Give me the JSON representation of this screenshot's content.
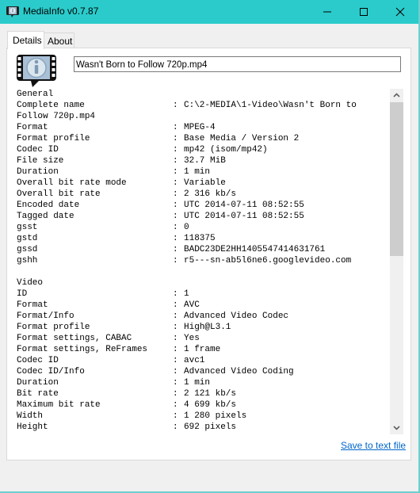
{
  "window": {
    "title": "MediaInfo v0.7.87",
    "minimize_icon": "minimize-icon",
    "maximize_icon": "maximize-icon",
    "close_icon": "close-icon",
    "titlebar_color": "#2bcbcb"
  },
  "tabs": [
    {
      "label": "Details",
      "active": true
    },
    {
      "label": "About",
      "active": false
    }
  ],
  "file": {
    "name": "Wasn't Born to Follow 720p.mp4",
    "logo_icon": "mediainfo-logo-icon"
  },
  "info": {
    "general_header": "General",
    "general": [
      {
        "key": "Complete name",
        "value": "C:\\2-MEDIA\\1-Video\\Wasn't Born to"
      },
      {
        "key": "Follow 720p.mp4",
        "value": ""
      },
      {
        "key": "Format",
        "value": "MPEG-4"
      },
      {
        "key": "Format profile",
        "value": "Base Media / Version 2"
      },
      {
        "key": "Codec ID",
        "value": "mp42 (isom/mp42)"
      },
      {
        "key": "File size",
        "value": "32.7 MiB"
      },
      {
        "key": "Duration",
        "value": "1 min"
      },
      {
        "key": "Overall bit rate mode",
        "value": "Variable"
      },
      {
        "key": "Overall bit rate",
        "value": "2 316 kb/s"
      },
      {
        "key": "Encoded date",
        "value": "UTC 2014-07-11 08:52:55"
      },
      {
        "key": "Tagged date",
        "value": "UTC 2014-07-11 08:52:55"
      },
      {
        "key": "gsst",
        "value": "0"
      },
      {
        "key": "gstd",
        "value": "118375"
      },
      {
        "key": "gssd",
        "value": "BADC23DE2HH1405547414631761"
      },
      {
        "key": "gshh",
        "value": "r5---sn-ab5l6ne6.googlevideo.com"
      }
    ],
    "video_header": "Video",
    "video": [
      {
        "key": "ID",
        "value": "1"
      },
      {
        "key": "Format",
        "value": "AVC"
      },
      {
        "key": "Format/Info",
        "value": "Advanced Video Codec"
      },
      {
        "key": "Format profile",
        "value": "High@L3.1"
      },
      {
        "key": "Format settings, CABAC",
        "value": "Yes"
      },
      {
        "key": "Format settings, ReFrames",
        "value": "1 frame"
      },
      {
        "key": "Codec ID",
        "value": "avc1"
      },
      {
        "key": "Codec ID/Info",
        "value": "Advanced Video Coding"
      },
      {
        "key": "Duration",
        "value": "1 min"
      },
      {
        "key": "Bit rate",
        "value": "2 121 kb/s"
      },
      {
        "key": "Maximum bit rate",
        "value": "4 699 kb/s"
      },
      {
        "key": "Width",
        "value": "1 280 pixels"
      },
      {
        "key": "Height",
        "value": "692 pixels"
      }
    ],
    "separator": ":"
  },
  "scrollbar": {
    "up_icon": "chevron-up-icon",
    "down_icon": "chevron-down-icon",
    "scroll_position_fraction": 0.0
  },
  "actions": {
    "save_label": "Save to text file",
    "link_color": "#0066cc"
  }
}
